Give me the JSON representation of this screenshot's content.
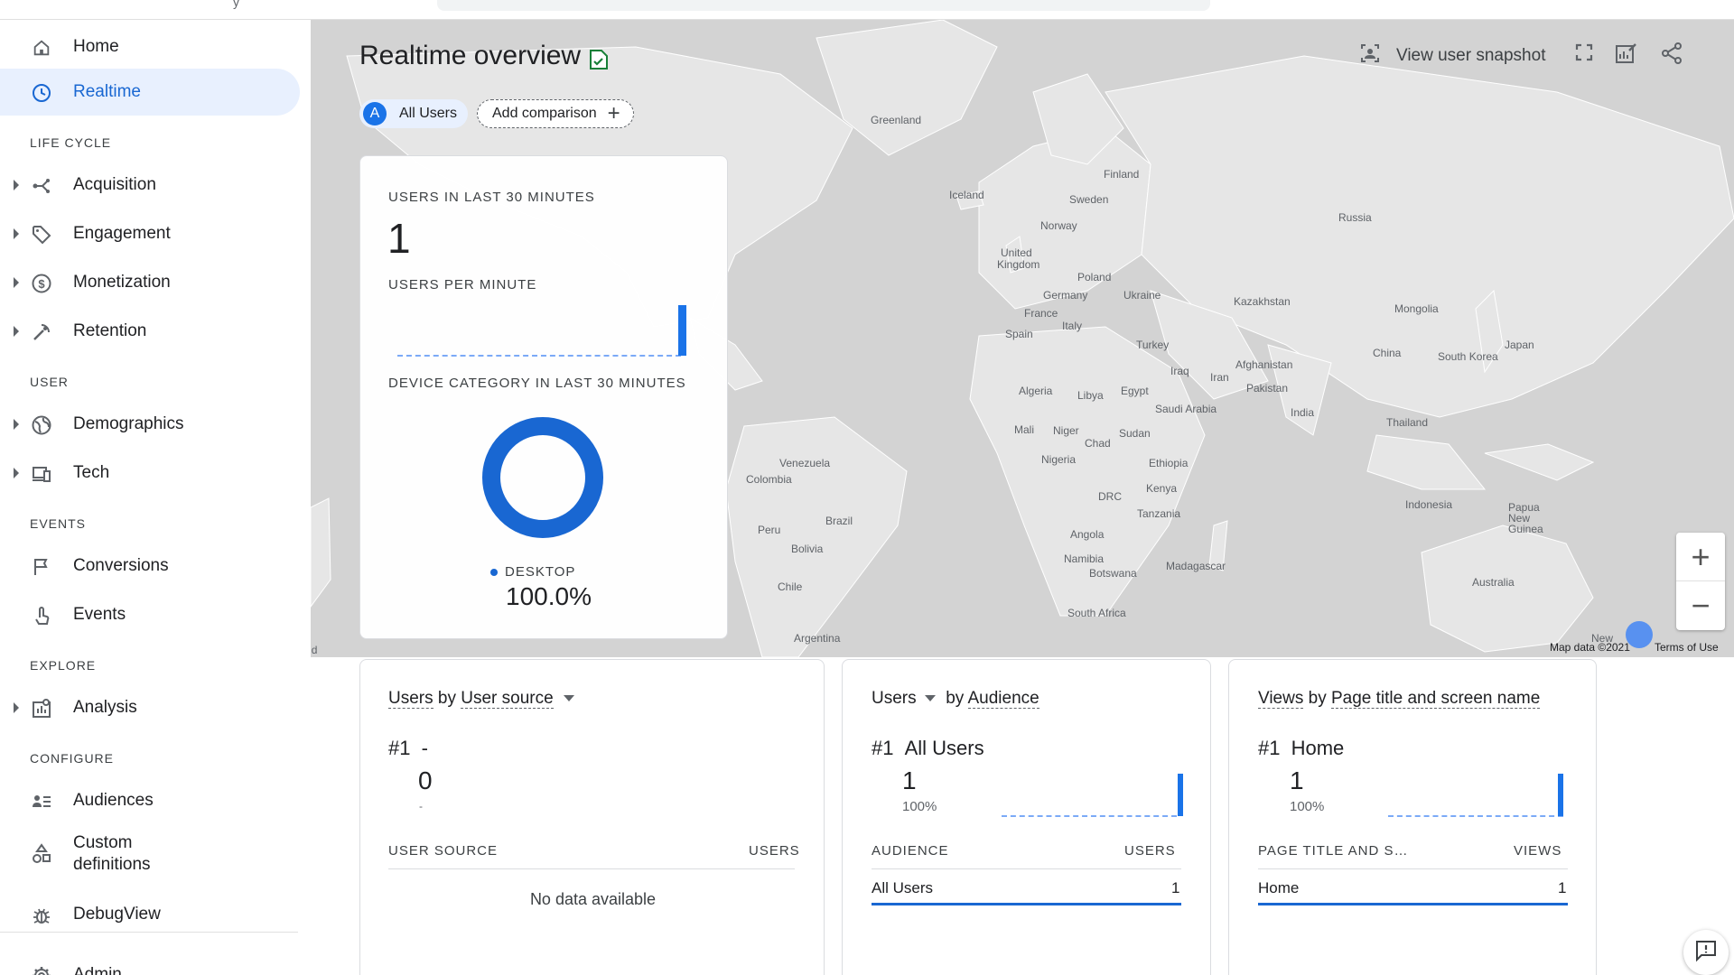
{
  "topbar": {
    "fragment": "y"
  },
  "sidebar": {
    "items": [
      {
        "label": "Home"
      },
      {
        "label": "Realtime"
      },
      {
        "label": "Acquisition"
      },
      {
        "label": "Engagement"
      },
      {
        "label": "Monetization"
      },
      {
        "label": "Retention"
      },
      {
        "label": "Demographics"
      },
      {
        "label": "Tech"
      },
      {
        "label": "Conversions"
      },
      {
        "label": "Events"
      },
      {
        "label": "Analysis"
      },
      {
        "label": "Audiences"
      },
      {
        "label": "Custom definitions"
      },
      {
        "label": "DebugView"
      },
      {
        "label": "Admin"
      }
    ],
    "sections": {
      "life_cycle": "LIFE CYCLE",
      "user": "USER",
      "events": "EVENTS",
      "explore": "EXPLORE",
      "configure": "CONFIGURE"
    },
    "custom_line1": "Custom",
    "custom_line2": "definitions"
  },
  "header": {
    "title": "Realtime overview",
    "view_user_snapshot": "View user snapshot",
    "all_users_avatar": "A",
    "all_users": "All Users",
    "add_comparison": "Add comparison"
  },
  "map": {
    "places": [
      "Greenland",
      "Iceland",
      "Finland",
      "Sweden",
      "Norway",
      "Russia",
      "United",
      "Kingdom",
      "Poland",
      "Germany",
      "Ukraine",
      "France",
      "Italy",
      "Spain",
      "Kazakhstan",
      "Mongolia",
      "Turkey",
      "Iraq",
      "Iran",
      "Afghanistan",
      "Pakistan",
      "China",
      "South Korea",
      "Japan",
      "Algeria",
      "Libya",
      "Egypt",
      "Saudi Arabia",
      "India",
      "Thailand",
      "Mali",
      "Niger",
      "Chad",
      "Sudan",
      "Nigeria",
      "Ethiopia",
      "Kenya",
      "DRC",
      "Tanzania",
      "Angola",
      "Namibia",
      "Botswana",
      "Madagascar",
      "South Africa",
      "Venezuela",
      "Colombia",
      "Peru",
      "Brazil",
      "Bolivia",
      "Chile",
      "Argentina",
      "Indonesia",
      "Papua New Guinea",
      "Australia",
      "New Zealand",
      "New"
    ],
    "map_data": "Map data ©2021",
    "terms": "Terms of Use",
    "zoom_in": "+",
    "zoom_out": "−"
  },
  "users_card": {
    "users_30_label": "USERS IN LAST 30 MINUTES",
    "users_30_value": "1",
    "per_minute_label": "USERS PER MINUTE",
    "device_label": "DEVICE CATEGORY IN LAST 30 MINUTES",
    "device_legend": "DESKTOP",
    "device_pct": "100.0%"
  },
  "source_card": {
    "title_metric": "Users",
    "title_by": "by",
    "title_dim": "User source",
    "rank": "#1",
    "rank_name": "-",
    "value": "0",
    "sub": "-",
    "col1": "USER SOURCE",
    "col2": "USERS",
    "empty": "No data available"
  },
  "audience_card": {
    "title_metric": "Users",
    "title_by": "by",
    "title_dim": "Audience",
    "rank": "#1",
    "rank_name": "All Users",
    "value": "1",
    "pct": "100%",
    "col1": "AUDIENCE",
    "col2": "USERS",
    "row_name": "All Users",
    "row_value": "1"
  },
  "views_card": {
    "title_metric": "Views",
    "title_by": "by",
    "title_dim": "Page title and screen name",
    "rank": "#1",
    "rank_name": "Home",
    "value": "1",
    "pct": "100%",
    "col1": "PAGE TITLE AND S…",
    "col2": "VIEWS",
    "row_name": "Home",
    "row_value": "1"
  },
  "colors": {
    "accent": "#1a73e8",
    "active_bg": "#e8f0fe",
    "map_land": "#e6e6e6",
    "map_water": "#d3d3d3"
  }
}
